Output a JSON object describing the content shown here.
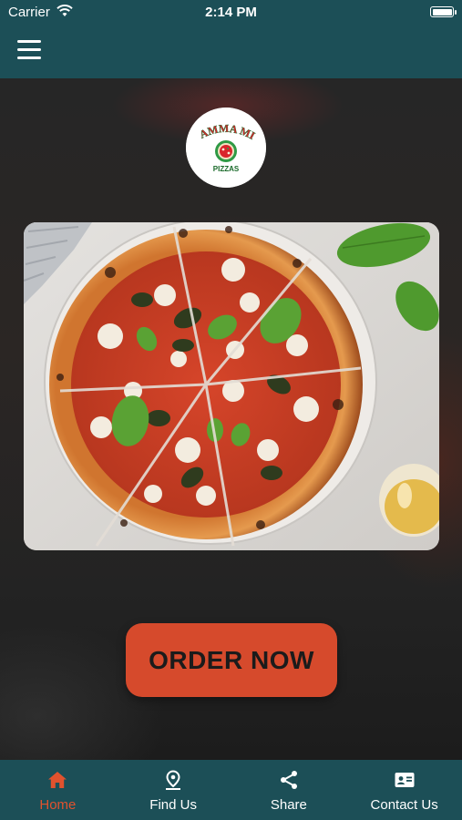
{
  "status_bar": {
    "carrier": "Carrier",
    "time": "2:14 PM"
  },
  "logo": {
    "line1": "MAMMA MIA",
    "line2": "PIZZAS"
  },
  "order_button": {
    "label": "ORDER NOW"
  },
  "tabs": [
    {
      "label": "Home",
      "icon": "home-icon",
      "active": true
    },
    {
      "label": "Find Us",
      "icon": "location-pin-icon",
      "active": false
    },
    {
      "label": "Share",
      "icon": "share-icon",
      "active": false
    },
    {
      "label": "Contact Us",
      "icon": "contact-card-icon",
      "active": false
    }
  ],
  "colors": {
    "bar": "#1c4f57",
    "accent": "#e0522e",
    "button": "#d64a2c"
  }
}
